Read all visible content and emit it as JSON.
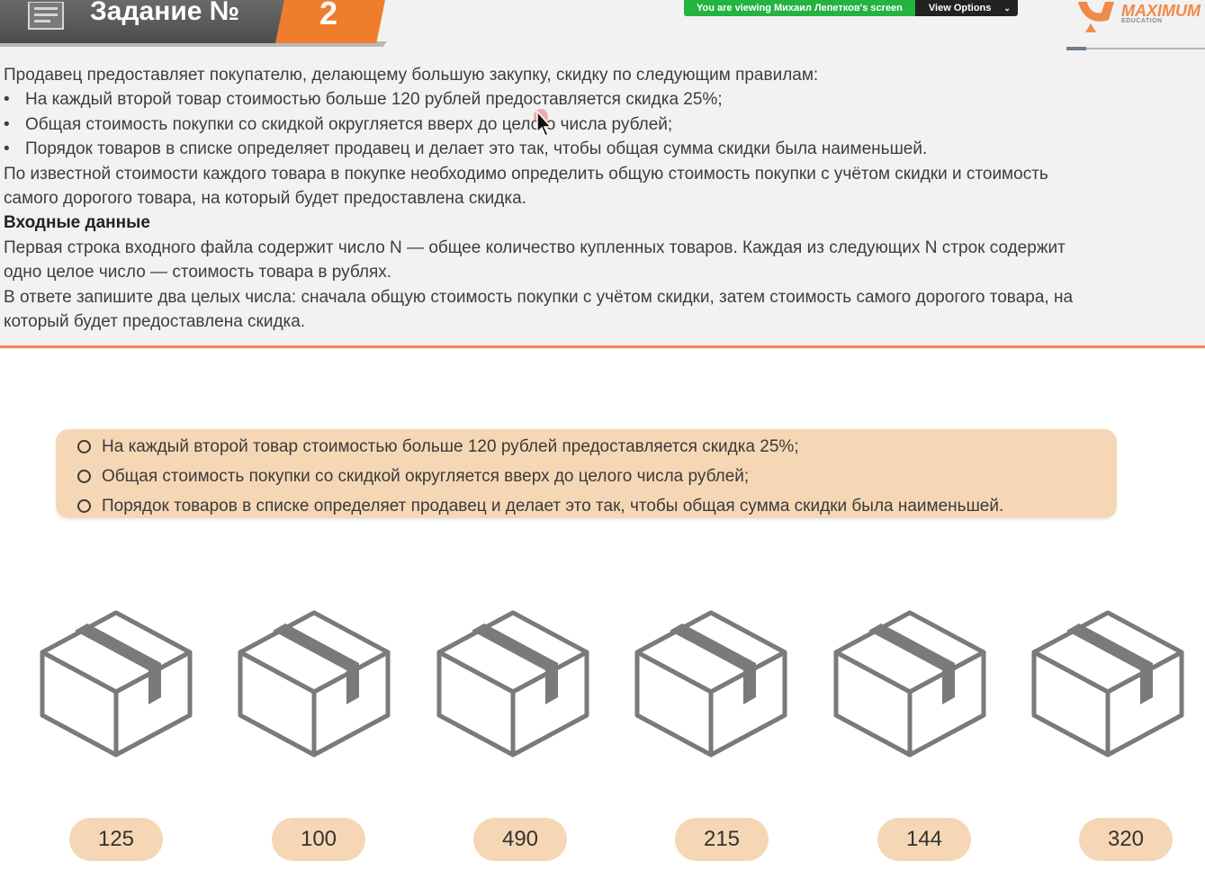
{
  "header": {
    "task_title": "Задание №",
    "task_number": "2"
  },
  "share_bar": {
    "status": "You are viewing Михаил Лепетков's screen",
    "options_label": "View Options"
  },
  "logo": {
    "name": "MAXIMUM",
    "sub": "EDUCATION"
  },
  "task": {
    "intro": "Продавец предоставляет покупателю, делающему большую закупку, скидку по следующим правилам:",
    "bullets": [
      "На каждый второй товар стоимостью больше 120 рублей предоставляется скидка 25%;",
      "Общая стоимость покупки со скидкой округляется вверх до целого числа рублей;",
      "Порядок товаров в списке определяет продавец и делает это так, чтобы общая сумма скидки была наименьшей."
    ],
    "question_line1": "По известной стоимости каждого товара в покупке необходимо определить общую стоимость покупки с учётом скидки и стоимость",
    "question_line2": "самого дорогого товара, на который будет предоставлена скидка.",
    "input_heading": "Входные данные",
    "input_line1": "Первая строка входного файла содержит число N — общее количество купленных товаров. Каждая из следующих N строк содержит",
    "input_line2": "одно целое число — стоимость товара в рублях.",
    "answer_line1": "В ответе запишите два целых числа: сначала общую стоимость покупки с учётом скидки, затем стоимость самого дорогого товара, на",
    "answer_line2": "который будет предоставлена скидка."
  },
  "rules": [
    "На каждый второй товар стоимостью больше 120 рублей предоставляется скидка 25%;",
    "Общая стоимость покупки со скидкой округляется вверх до целого числа рублей;",
    "Порядок товаров в списке определяет продавец и делает это так, чтобы общая сумма скидки была наименьшей."
  ],
  "items": [
    {
      "price": "125",
      "icon": "box-icon"
    },
    {
      "price": "100",
      "icon": "box-icon"
    },
    {
      "price": "490",
      "icon": "box-icon"
    },
    {
      "price": "215",
      "icon": "box-icon"
    },
    {
      "price": "144",
      "icon": "box-icon"
    },
    {
      "price": "320",
      "icon": "box-icon"
    }
  ],
  "colors": {
    "accent": "#ef7d2c",
    "tag_fill": "#f6d7b5",
    "share_green": "#23b341"
  }
}
